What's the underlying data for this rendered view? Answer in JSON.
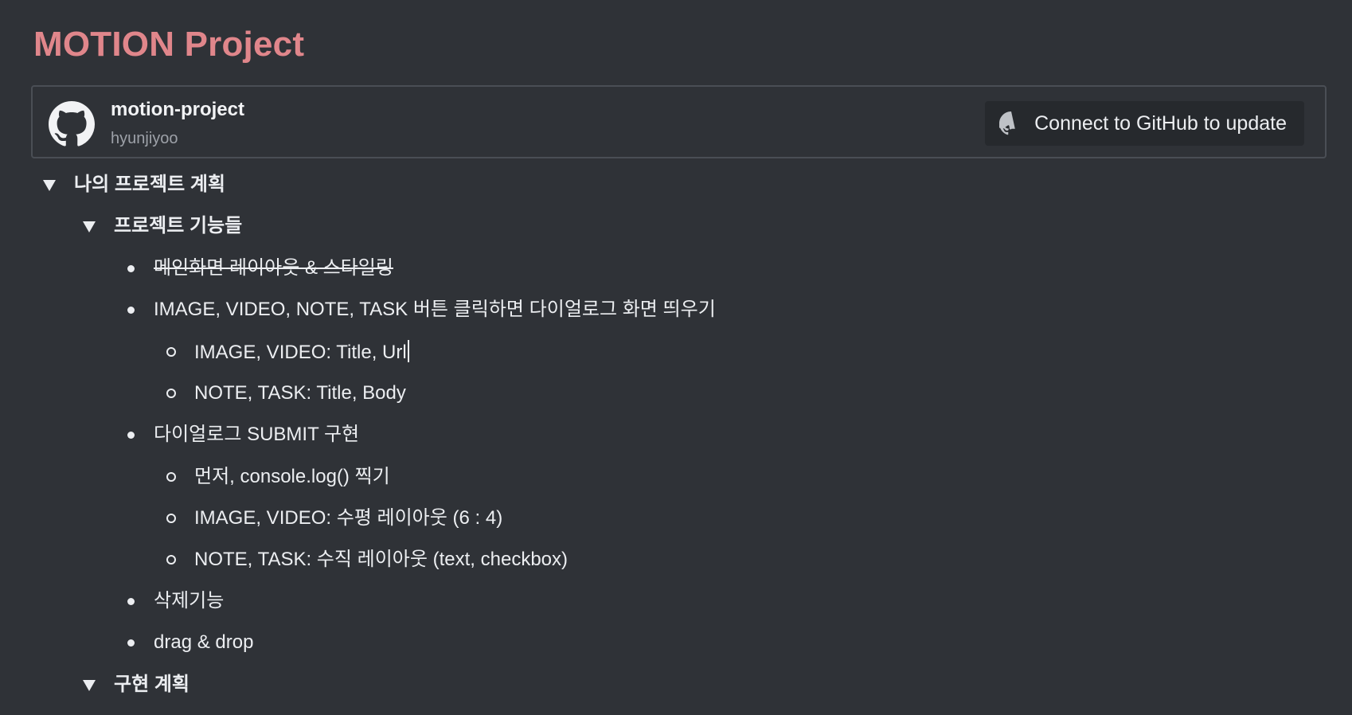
{
  "page": {
    "title": "MOTION Project"
  },
  "repo": {
    "name": "motion-project",
    "owner": "hyunjiyoo",
    "icon": "github-icon",
    "connect_label": "Connect to GitHub to update"
  },
  "outline": {
    "h1": "나의 프로젝트 계획",
    "features": {
      "heading": "프로젝트 기능들",
      "item1": "메인화면 레이아웃 & 스타일링",
      "item2": "IMAGE, VIDEO, NOTE, TASK 버튼 클릭하면 다이얼로그 화면 띄우기",
      "item2_sub1": "IMAGE, VIDEO: Title, Url",
      "item2_sub2": "NOTE, TASK: Title, Body",
      "item3": "다이얼로그 SUBMIT 구현",
      "item3_sub1": "먼저, console.log() 찍기",
      "item3_sub2": "IMAGE, VIDEO: 수평 레이아웃 (6 : 4)",
      "item3_sub3": "NOTE, TASK: 수직 레이아웃 (text, checkbox)",
      "item4": "삭제기능",
      "item5": "drag & drop"
    },
    "plan_heading": "구현 계획"
  },
  "colors": {
    "background": "#2f3237",
    "title": "#e0868b",
    "text": "#eceef1",
    "muted": "#9da1a8",
    "button_bg": "#26292d",
    "border": "#4a4e55"
  }
}
